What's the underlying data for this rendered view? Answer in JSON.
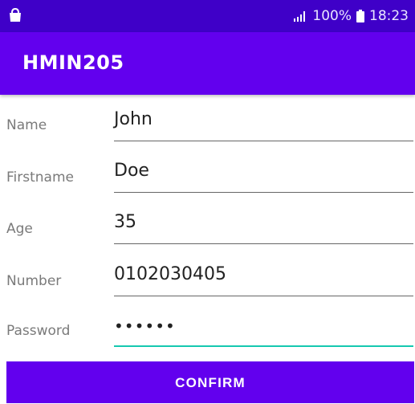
{
  "statusbar": {
    "left_icon": "shopping-bag-icon",
    "signal_icon": "signal-icon",
    "battery_text": "100%",
    "battery_icon": "battery-icon",
    "time": "18:23"
  },
  "appbar": {
    "title": "HMIN205"
  },
  "form": {
    "fields": [
      {
        "label": "Name",
        "value": "John"
      },
      {
        "label": "Firstname",
        "value": "Doe"
      },
      {
        "label": "Age",
        "value": "35"
      },
      {
        "label": "Number",
        "value": "0102030405"
      },
      {
        "label": "Password",
        "value": "••••••"
      }
    ]
  },
  "confirm_label": "CONFIRM",
  "colors": {
    "statusbar": "#3f00c8",
    "primary": "#6200ee",
    "active_underline": "#16c8b0"
  }
}
